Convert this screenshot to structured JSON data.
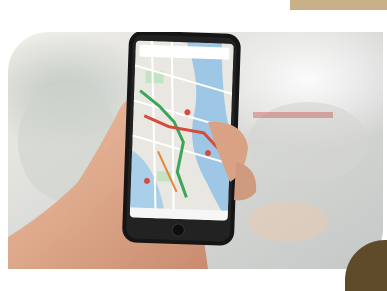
{
  "image": {
    "subject": "hand-holding-smartphone-with-map",
    "colors": {
      "accent_gold": "#c8b189",
      "accent_dark": "#5f4b2a",
      "background_blur": "#e7e6e3",
      "river_blue": "#9ec7e6",
      "map_land": "#e9e7e1",
      "route_green": "#3aa657",
      "route_red": "#d84a3c",
      "phone_body": "#1a1a1a",
      "skin": "#e8b79a"
    }
  }
}
